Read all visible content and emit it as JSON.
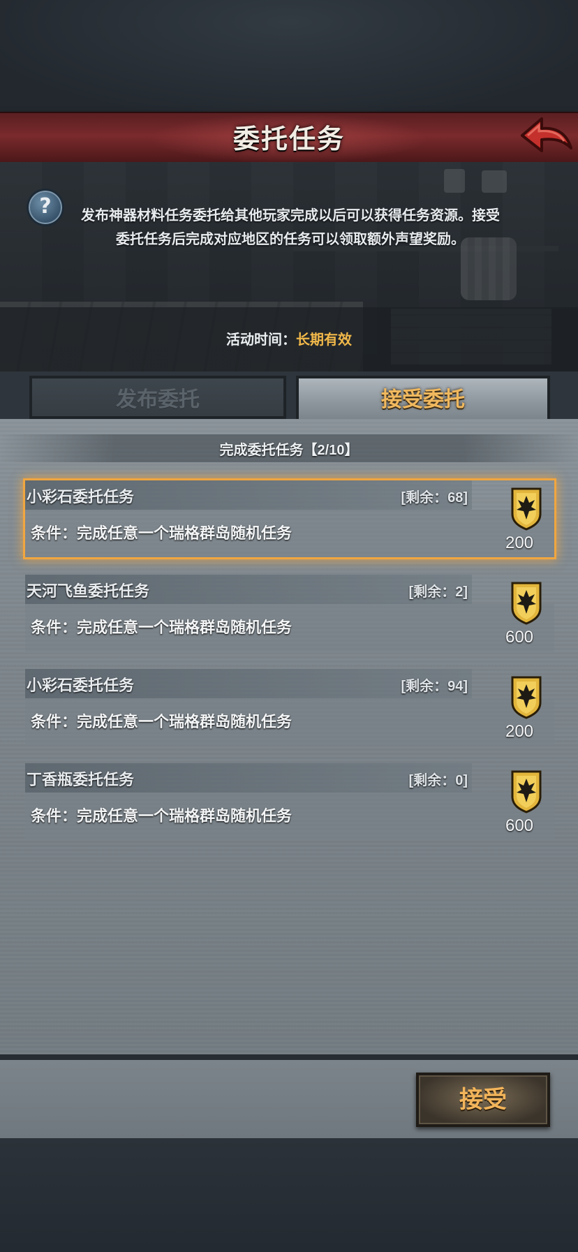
{
  "header": {
    "title": "委托任务"
  },
  "intro": {
    "line1": "发布神器材料任务委托给其他玩家完成以后可以获得任务资源。接受",
    "line2": "委托任务后完成对应地区的任务可以领取额外声望奖励。"
  },
  "event_time": {
    "label": "活动时间：",
    "value": "长期有效"
  },
  "tabs": [
    {
      "label": "发布委托",
      "active": false
    },
    {
      "label": "接受委托",
      "active": true
    }
  ],
  "progress": "完成委托任务【2/10】",
  "tasks": [
    {
      "name": "小彩石委托任务",
      "remaining": "[剩余：68]",
      "condition": "条件：完成任意一个瑞格群岛随机任务",
      "reward": "200",
      "selected": true
    },
    {
      "name": "天河飞鱼委托任务",
      "remaining": "[剩余：2]",
      "condition": "条件：完成任意一个瑞格群岛随机任务",
      "reward": "600",
      "selected": false
    },
    {
      "name": "小彩石委托任务",
      "remaining": "[剩余：94]",
      "condition": "条件：完成任意一个瑞格群岛随机任务",
      "reward": "200",
      "selected": false
    },
    {
      "name": "丁香瓶委托任务",
      "remaining": "[剩余：0]",
      "condition": "条件：完成任意一个瑞格群岛随机任务",
      "reward": "600",
      "selected": false
    }
  ],
  "accept_button": "接受",
  "icons": {
    "help": "question-icon",
    "back": "back-arrow-icon",
    "reward": "reputation-shield-icon"
  },
  "colors": {
    "accent_gold": "#f1b84a",
    "banner_red": "#7a2a2c",
    "selection_glow": "#f0a640"
  }
}
